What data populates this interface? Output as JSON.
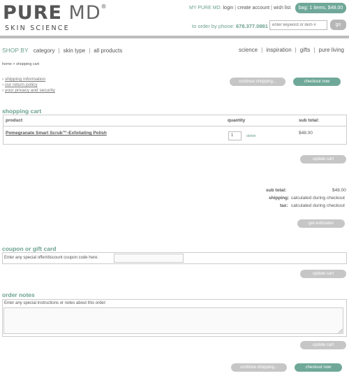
{
  "brand": {
    "name_bold": "PURE",
    "name_light": "MD",
    "registered": "®",
    "tagline": "SKIN SCIENCE"
  },
  "header": {
    "my_account_label": "MY PURE MD:",
    "login": "login",
    "create_account": "create account",
    "wish_list": "wish list",
    "bag": "bag: 1 items, $48.00",
    "phone_label": "to order by phone:",
    "phone_number": "678.377.0881",
    "search_placeholder": "enter keyword or item #",
    "go": "go"
  },
  "nav": {
    "shop_by": "SHOP BY",
    "left": [
      "category",
      "skin type",
      "all products"
    ],
    "right": [
      "science",
      "inspiration",
      "gifts",
      "pure living"
    ]
  },
  "breadcrumb": {
    "home": "home",
    "separator": ">",
    "current": "shopping cart"
  },
  "info_links": [
    "shipping information",
    "our return policy",
    "your privacy and security"
  ],
  "buttons": {
    "continue_shopping": "continue shopping...",
    "checkout_now": "checkout now",
    "update_cart": "update cart",
    "get_estimates": "get estimates"
  },
  "cart": {
    "title": "shopping cart",
    "columns": {
      "product": "product",
      "quantity": "quantity",
      "subtotal": "sub total:"
    },
    "items": [
      {
        "name": "Pomegranate Smart Scrub™-Exfoliating Polish",
        "quantity": "1",
        "delete": "delete",
        "subtotal": "$48.00"
      }
    ]
  },
  "totals": {
    "subtotal_label": "sub total:",
    "subtotal_value": "$48.00",
    "shipping_label": "shipping:",
    "shipping_value": "calculated during checkout",
    "tax_label": "tax:",
    "tax_value": "calculated during checkout"
  },
  "coupon": {
    "title": "coupon or gift card",
    "label": "Enter any special offer/discount coupon code here:"
  },
  "notes": {
    "title": "order notes",
    "label": "Enter any special instructions or notes about this order:"
  },
  "colors": {
    "accent": "#6ba08f",
    "button_green": "#6fa898",
    "button_gray": "#c6c6c6"
  }
}
